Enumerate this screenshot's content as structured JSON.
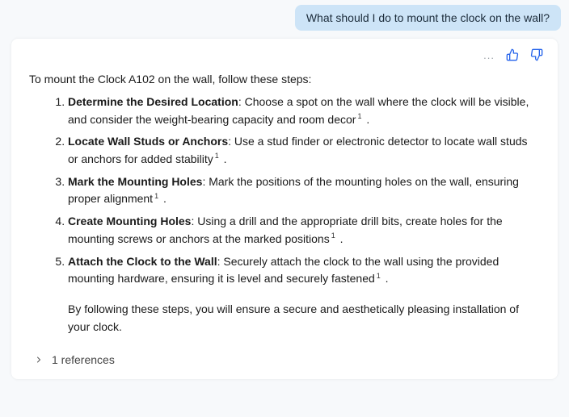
{
  "user_message": "What should I do to mount the clock on the wall?",
  "intro": "To mount the Clock A102 on the wall, follow these steps:",
  "steps": [
    {
      "title": "Determine the Desired Location",
      "body": ": Choose a spot on the wall where the clock will be visible, and consider the weight-bearing capacity and room decor",
      "cite": "1"
    },
    {
      "title": "Locate Wall Studs or Anchors",
      "body": ": Use a stud finder or electronic detector to locate wall studs or anchors for added stability",
      "cite": "1"
    },
    {
      "title": "Mark the Mounting Holes",
      "body": ": Mark the positions of the mounting holes on the wall, ensuring proper alignment",
      "cite": "1"
    },
    {
      "title": "Create Mounting Holes",
      "body": ": Using a drill and the appropriate drill bits, create holes for the mounting screws or anchors at the marked positions",
      "cite": "1"
    },
    {
      "title": "Attach the Clock to the Wall",
      "body": ": Securely attach the clock to the wall using the provided mounting hardware, ensuring it is level and securely fastened",
      "cite": "1"
    }
  ],
  "closing": "By following these steps, you will ensure a secure and aesthetically pleasing installation of your clock.",
  "references_label": "1 references",
  "actions": {
    "more": "...",
    "thumbs_up": "thumbs-up",
    "thumbs_down": "thumbs-down"
  }
}
